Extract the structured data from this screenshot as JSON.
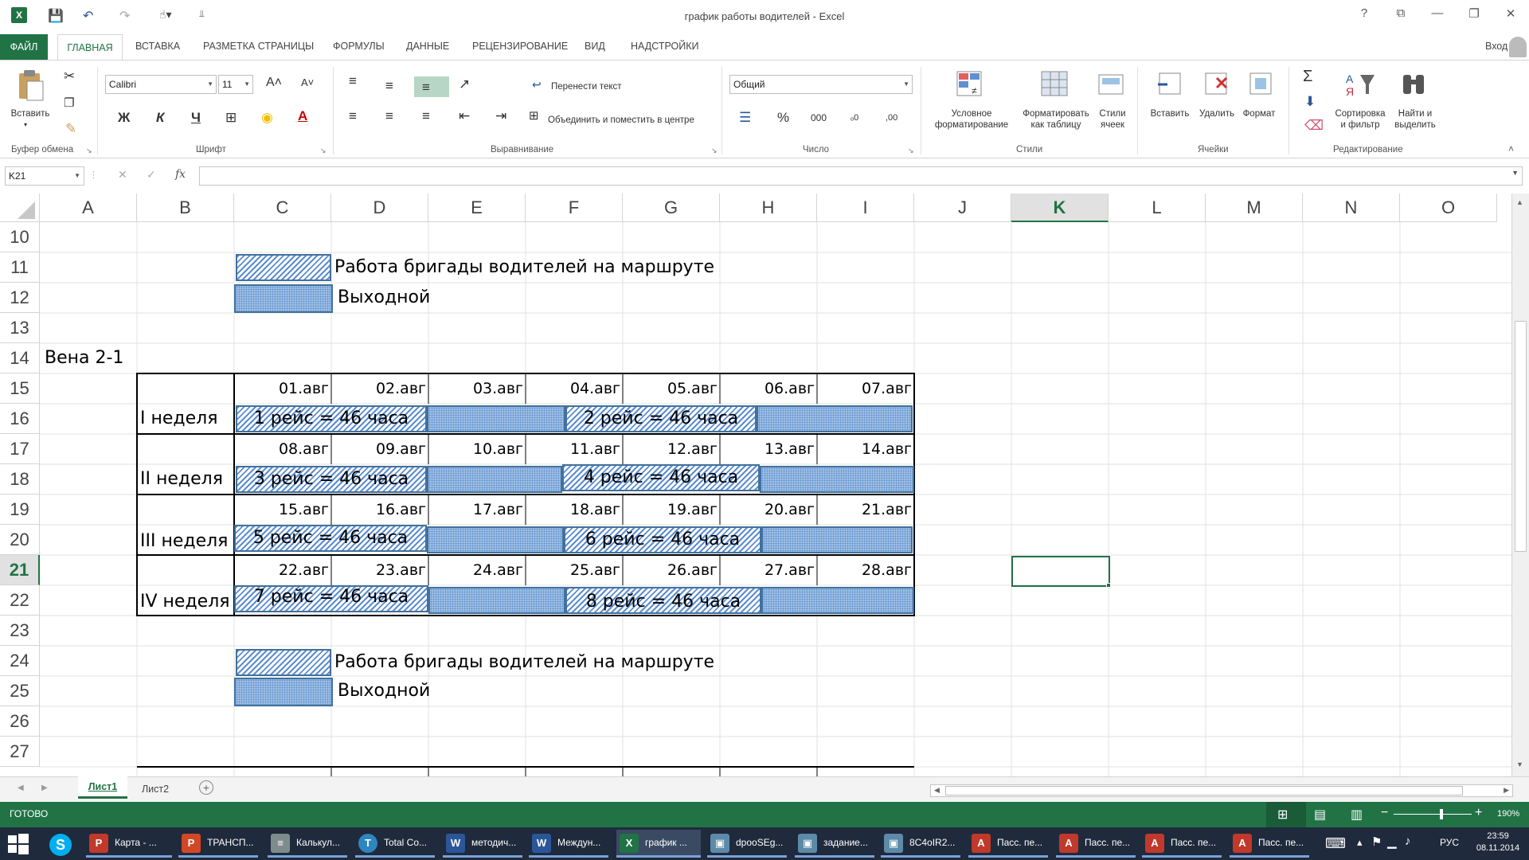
{
  "window": {
    "title": "график работы водителей - Excel",
    "help": "?",
    "restore": "⧉",
    "minimize": "—",
    "maximize": "❐",
    "close": "✕",
    "signin": "Вход"
  },
  "tabs": [
    "ФАЙЛ",
    "ГЛАВНАЯ",
    "ВСТАВКА",
    "РАЗМЕТКА СТРАНИЦЫ",
    "ФОРМУЛЫ",
    "ДАННЫЕ",
    "РЕЦЕНЗИРОВАНИЕ",
    "ВИД",
    "НАДСТРОЙКИ"
  ],
  "ribbon": {
    "clipboard": {
      "paste": "Вставить",
      "label": "Буфер обмена"
    },
    "font": {
      "name": "Calibri",
      "size": "11",
      "bold": "Ж",
      "italic": "К",
      "underline": "Ч",
      "grow": "A˄",
      "shrink": "A˅",
      "label": "Шрифт"
    },
    "alignment": {
      "wrap": "Перенести текст",
      "merge": "Объединить и поместить в центре",
      "label": "Выравнивание"
    },
    "number": {
      "format": "Общий",
      "percent": "%",
      "thousands": "000",
      "inc": "ₒ0",
      "dec": ",00",
      "label": "Число"
    },
    "styles": {
      "conditional_1": "Условное",
      "conditional_2": "форматирование",
      "table_1": "Форматировать",
      "table_2": "как таблицу",
      "cell_1": "Стили",
      "cell_2": "ячеек",
      "label": "Стили"
    },
    "cells": {
      "insert": "Вставить",
      "delete": "Удалить",
      "format": "Формат",
      "label": "Ячейки"
    },
    "editing": {
      "sum": "Σ",
      "sort_1": "Сортировка",
      "sort_2": "и фильтр",
      "find_1": "Найти и",
      "find_2": "выделить",
      "label": "Редактирование"
    }
  },
  "formula_bar": {
    "name_box": "K21",
    "fx": "fx",
    "cancel": "✕",
    "enter": "✓",
    "value": ""
  },
  "columns": [
    "A",
    "B",
    "C",
    "D",
    "E",
    "F",
    "G",
    "H",
    "I",
    "J",
    "K",
    "L",
    "M",
    "N",
    "O"
  ],
  "rows": [
    "10",
    "11",
    "12",
    "13",
    "14",
    "15",
    "16",
    "17",
    "18",
    "19",
    "20",
    "21",
    "22",
    "23",
    "24",
    "25",
    "26",
    "27"
  ],
  "sheet": {
    "legend_work": "Работа бригады водителей на маршруте",
    "legend_off": "Выходной",
    "route": "Вена 2-1",
    "weeks": [
      {
        "label": "I неделя",
        "dates": [
          "01.авг",
          "02.авг",
          "03.авг",
          "04.авг",
          "05.авг",
          "06.авг",
          "07.авг"
        ],
        "trip1": "1 рейс = 46 часа",
        "trip2": "2 рейс = 46 часа"
      },
      {
        "label": "II неделя",
        "dates": [
          "08.авг",
          "09.авг",
          "10.авг",
          "11.авг",
          "12.авг",
          "13.авг",
          "14.авг"
        ],
        "trip1": "3 рейс = 46 часа",
        "trip2": "4 рейс = 46 часа"
      },
      {
        "label": "III неделя",
        "dates": [
          "15.авг",
          "16.авг",
          "17.авг",
          "18.авг",
          "19.авг",
          "20.авг",
          "21.авг"
        ],
        "trip1": "5 рейс = 46 часа",
        "trip2": "6 рейс = 46 часа"
      },
      {
        "label": "IV неделя",
        "dates": [
          "22.авг",
          "23.авг",
          "24.авг",
          "25.авг",
          "26.авг",
          "27.авг",
          "28.авг"
        ],
        "trip1": "7 рейс = 46 часа",
        "trip2": "8 рейс = 46 часа"
      }
    ]
  },
  "sheets": [
    "Лист1",
    "Лист2"
  ],
  "status": {
    "ready": "ГОТОВО",
    "zoom": "190%"
  },
  "taskbar": {
    "items": [
      "Карта - ...",
      "ТРАНСП...",
      "Калькул...",
      "Total Co...",
      "методич...",
      "Междун...",
      "график ...",
      "dpooSEg...",
      "задание...",
      "8C4oIR2...",
      "Пасс. пе...",
      "Пасс. пе...",
      "Пасс. пе...",
      "Пасс. пе..."
    ],
    "lang": "РУС",
    "time": "23:59",
    "date": "08.11.2014"
  },
  "colors": {
    "excel_green": "#217346",
    "border_blue": "#41719c",
    "hatch_blue": "#5b8ccf",
    "dot_blue": "#a9c7ea"
  }
}
